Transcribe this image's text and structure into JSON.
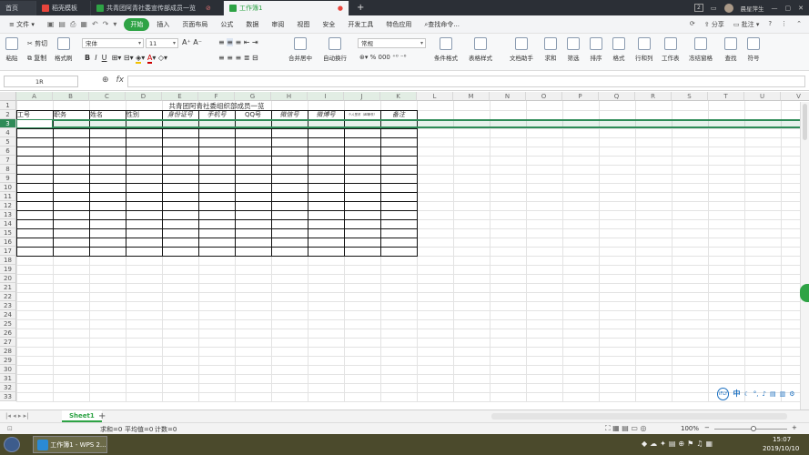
{
  "tabs": [
    {
      "label": "首页",
      "color": "#2b2f36"
    },
    {
      "label": "稻壳模板",
      "color": "#e8453c"
    },
    {
      "label": "共青团阿青社委宣传部成员一览",
      "color": "#2ea345"
    },
    {
      "label": "工作簿1",
      "color": "#2ea345",
      "active": true
    }
  ],
  "titlebar_right": {
    "badge": "2",
    "user": "晨星萍生"
  },
  "menubar": {
    "file": "文件",
    "items": [
      "开始",
      "插入",
      "页面布局",
      "公式",
      "数据",
      "审阅",
      "视图",
      "安全",
      "开发工具",
      "特色应用"
    ],
    "search": "查找命令...",
    "share": "分享",
    "comment": "批注",
    "help": "?"
  },
  "ribbon": {
    "paste": "粘贴",
    "cut": "剪切",
    "copy": "复制",
    "format_painter": "格式刷",
    "font": "宋体",
    "size": "11",
    "merge": "合并居中",
    "wrap": "自动换行",
    "number_format": "常规",
    "cond_format": "条件格式",
    "table_style": "表格样式",
    "doc_helper": "文档助手",
    "sum": "求和",
    "filter": "筛选",
    "sort": "排序",
    "format": "格式",
    "rowcol": "行和列",
    "sheet": "工作表",
    "freeze": "冻结窗格",
    "find": "查找",
    "symbol": "符号",
    "percent": "%",
    "thousands": "000"
  },
  "formula_bar": {
    "namebox": "1R",
    "fx": "fx",
    "value": ""
  },
  "columns": [
    "A",
    "B",
    "C",
    "D",
    "E",
    "F",
    "G",
    "H",
    "I",
    "J",
    "K",
    "L",
    "M",
    "N",
    "O",
    "P",
    "Q",
    "R",
    "S",
    "T",
    "U",
    "V"
  ],
  "rows": [
    "1",
    "2",
    "3",
    "4",
    "5",
    "6",
    "7",
    "8",
    "9",
    "10",
    "11",
    "12",
    "13",
    "14",
    "15",
    "16",
    "17",
    "18",
    "19",
    "20",
    "21",
    "22",
    "23",
    "24",
    "25",
    "26",
    "27",
    "28",
    "29",
    "30",
    "31",
    "32",
    "33"
  ],
  "sheet_title": "共青团阿青社委组织部成员一览",
  "headers": [
    "工号",
    "职务",
    "姓名",
    "性别",
    "身份证号",
    "手机号",
    "QQ号",
    "微信号",
    "微博号",
    "个人签名（邮箱号）",
    "备注"
  ],
  "sheets": {
    "active": "Sheet1",
    "add": "+"
  },
  "status": {
    "sum": "求和=0",
    "avg": "平均值=0",
    "count": "计数=0",
    "zoom": "100%"
  },
  "taskbar": {
    "app": "工作簿1 - WPS 2...",
    "time": "15:07",
    "date": "2019/10/10"
  },
  "ime": {
    "logo": "iFLY",
    "mode": "中"
  },
  "colors": {
    "accent": "#2ea345",
    "selection": "#2e8b57"
  }
}
